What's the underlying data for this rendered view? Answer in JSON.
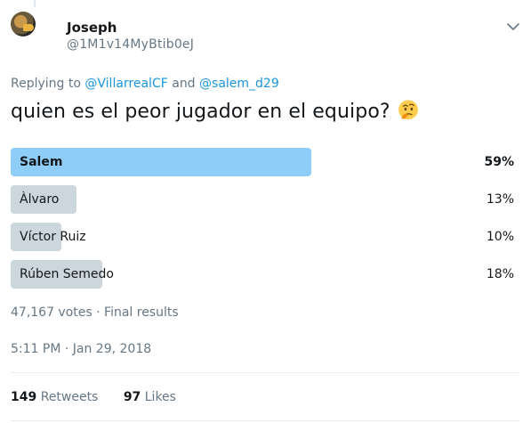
{
  "author": {
    "name": "Joseph",
    "handle": "@1M1v14MyBtib0eJ"
  },
  "icons": {
    "avatar": "avatar",
    "menu": "chevron-down-icon",
    "emoji": "thinking-face-emoji"
  },
  "reply": {
    "prefix": "Replying to",
    "mention1": "@VillarrealCF",
    "connector": "and",
    "mention2": "@salem_d29"
  },
  "tweet": {
    "text": "quien es el peor jugador en el equipo?"
  },
  "poll": {
    "options": [
      {
        "label": "Salem",
        "percent": "59%",
        "fraction": 0.59,
        "winner": true
      },
      {
        "label": "Àlvaro",
        "percent": "13%",
        "fraction": 0.13,
        "winner": false
      },
      {
        "label": "Víctor Ruiz",
        "percent": "10%",
        "fraction": 0.1,
        "winner": false
      },
      {
        "label": "Rúben Semedo",
        "percent": "18%",
        "fraction": 0.18,
        "winner": false
      }
    ],
    "summary": "47,167 votes · Final results"
  },
  "timestamp": "5:11 PM · Jan 29, 2018",
  "stats": {
    "retweets_count": "149",
    "retweets_label": "Retweets",
    "likes_count": "97",
    "likes_label": "Likes"
  },
  "colors": {
    "accent": "#1b95e0",
    "winner_bar": "#8ecdf8",
    "other_bar": "#ccd6dd"
  }
}
